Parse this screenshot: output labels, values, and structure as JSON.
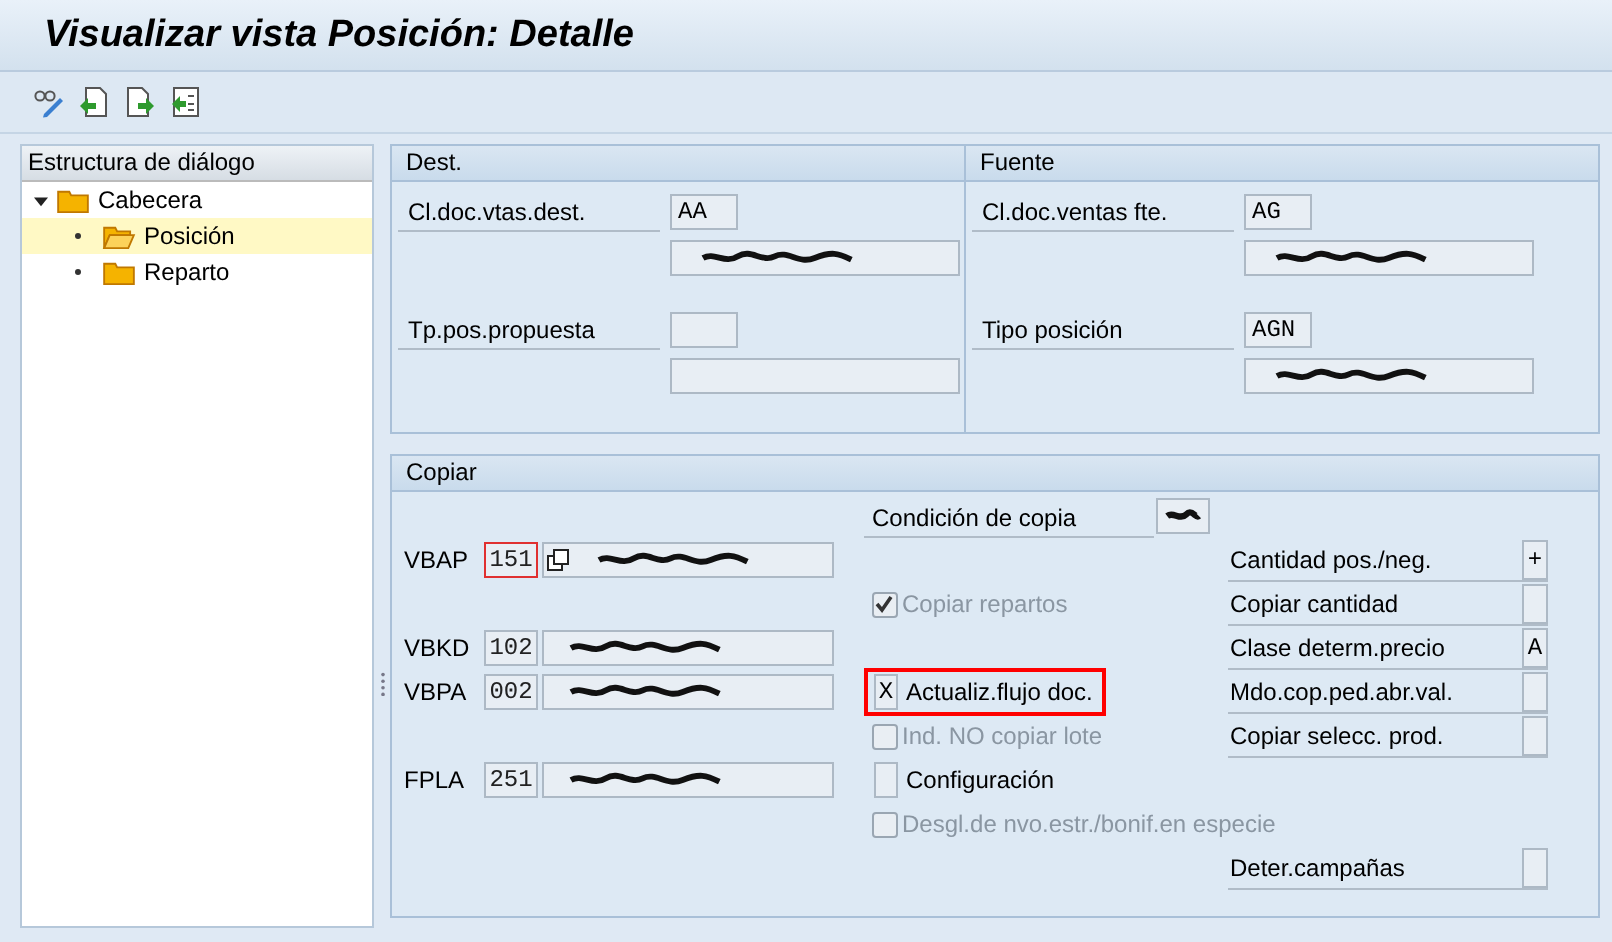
{
  "window": {
    "title": "Visualizar vista Posición: Detalle"
  },
  "toolbar": {
    "buttons": [
      {
        "kind": "display-change"
      },
      {
        "kind": "previous"
      },
      {
        "kind": "next"
      },
      {
        "kind": "other"
      }
    ]
  },
  "tree": {
    "title": "Estructura de diálogo",
    "items": [
      {
        "label": "Cabecera",
        "expanded": true,
        "selected": false,
        "children": [
          {
            "label": "Posición",
            "selected": true
          },
          {
            "label": "Reparto",
            "selected": false
          }
        ]
      }
    ]
  },
  "panels": [
    {
      "title": "Dest.",
      "fields": [
        {
          "label": "Cl.doc.vtas.dest.",
          "value": "AA",
          "description_redacted": true
        },
        {
          "label": "Tp.pos.propuesta",
          "description_redacted": false
        }
      ]
    },
    {
      "title": "Fuente",
      "fields": [
        {
          "label": "Cl.doc.ventas fte.",
          "value": "AG",
          "description_redacted": true
        },
        {
          "label": "Tipo posición",
          "value": "AGN",
          "description_redacted": true
        }
      ]
    }
  ],
  "copiar": {
    "title": "Copiar",
    "tables": [
      {
        "label": "VBAP",
        "value": "151",
        "focused": true
      },
      {
        "label": "VBKD",
        "value": "102",
        "focused": false
      },
      {
        "label": "VBPA",
        "value": "002",
        "focused": false
      },
      {
        "label": "FPLA",
        "value": "251",
        "focused": false
      }
    ],
    "options": [
      {
        "kind": "field",
        "label": "Condición de copia"
      },
      {
        "kind": "checkbox",
        "label": "Copiar repartos",
        "checked": true,
        "disabled": true
      },
      {
        "kind": "flag",
        "label": "Actualiz.flujo doc.",
        "value": "X",
        "highlighted": true
      },
      {
        "kind": "checkbox",
        "label": "Ind. NO copiar lote",
        "checked": false,
        "disabled": true
      },
      {
        "kind": "flag",
        "label": "Configuración",
        "highlighted": false
      },
      {
        "kind": "checkbox",
        "label": "Desgl.de nvo.estr./bonif.en especie",
        "checked": false,
        "disabled": true
      }
    ],
    "settings": [
      {
        "label": "Cantidad pos./neg.",
        "value": "+"
      },
      {
        "label": "Copiar cantidad"
      },
      {
        "label": "Clase determ.precio",
        "value": "A"
      },
      {
        "label": "Mdo.cop.ped.abr.val."
      },
      {
        "label": "Copiar selecc. prod."
      },
      {
        "label": "Deter.campañas"
      }
    ]
  }
}
